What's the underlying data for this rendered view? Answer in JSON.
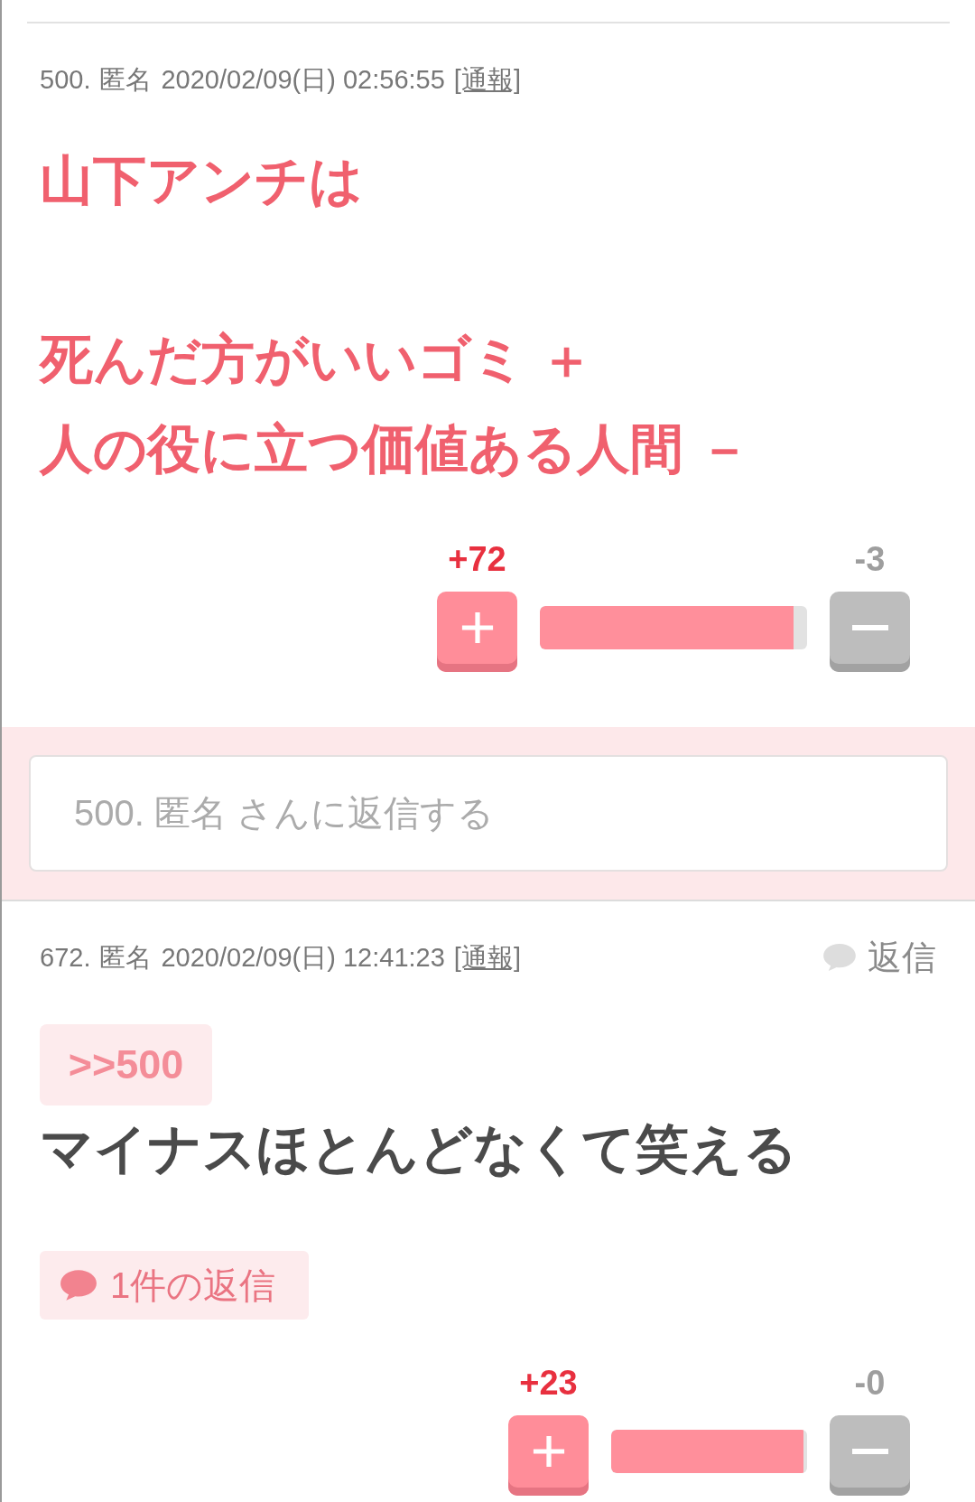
{
  "posts": [
    {
      "number": "500.",
      "author": "匿名",
      "datetime": "2020/02/09(日) 02:56:55",
      "report": "[通報]",
      "highlighted": true,
      "paragraphs": [
        [
          "山下アンチは"
        ],
        [
          "死んだ方がいいゴミ ＋",
          "人の役に立つ価値ある人間 －"
        ]
      ],
      "votes": {
        "plus": "+72",
        "minus": "-3",
        "level": 0.95
      },
      "reply_form": {
        "placeholder": "500. 匿名 さんに返信する"
      }
    },
    {
      "number": "672.",
      "author": "匿名",
      "datetime": "2020/02/09(日) 12:41:23",
      "report": "[通報]",
      "reply_link": "返信",
      "highlighted": false,
      "anchor": ">>500",
      "paragraphs": [
        [
          "マイナスほとんどなくて笑える"
        ]
      ],
      "reply_count": "1件の返信",
      "votes": {
        "plus": "+23",
        "minus": "-0",
        "level": 0.98
      }
    }
  ]
}
